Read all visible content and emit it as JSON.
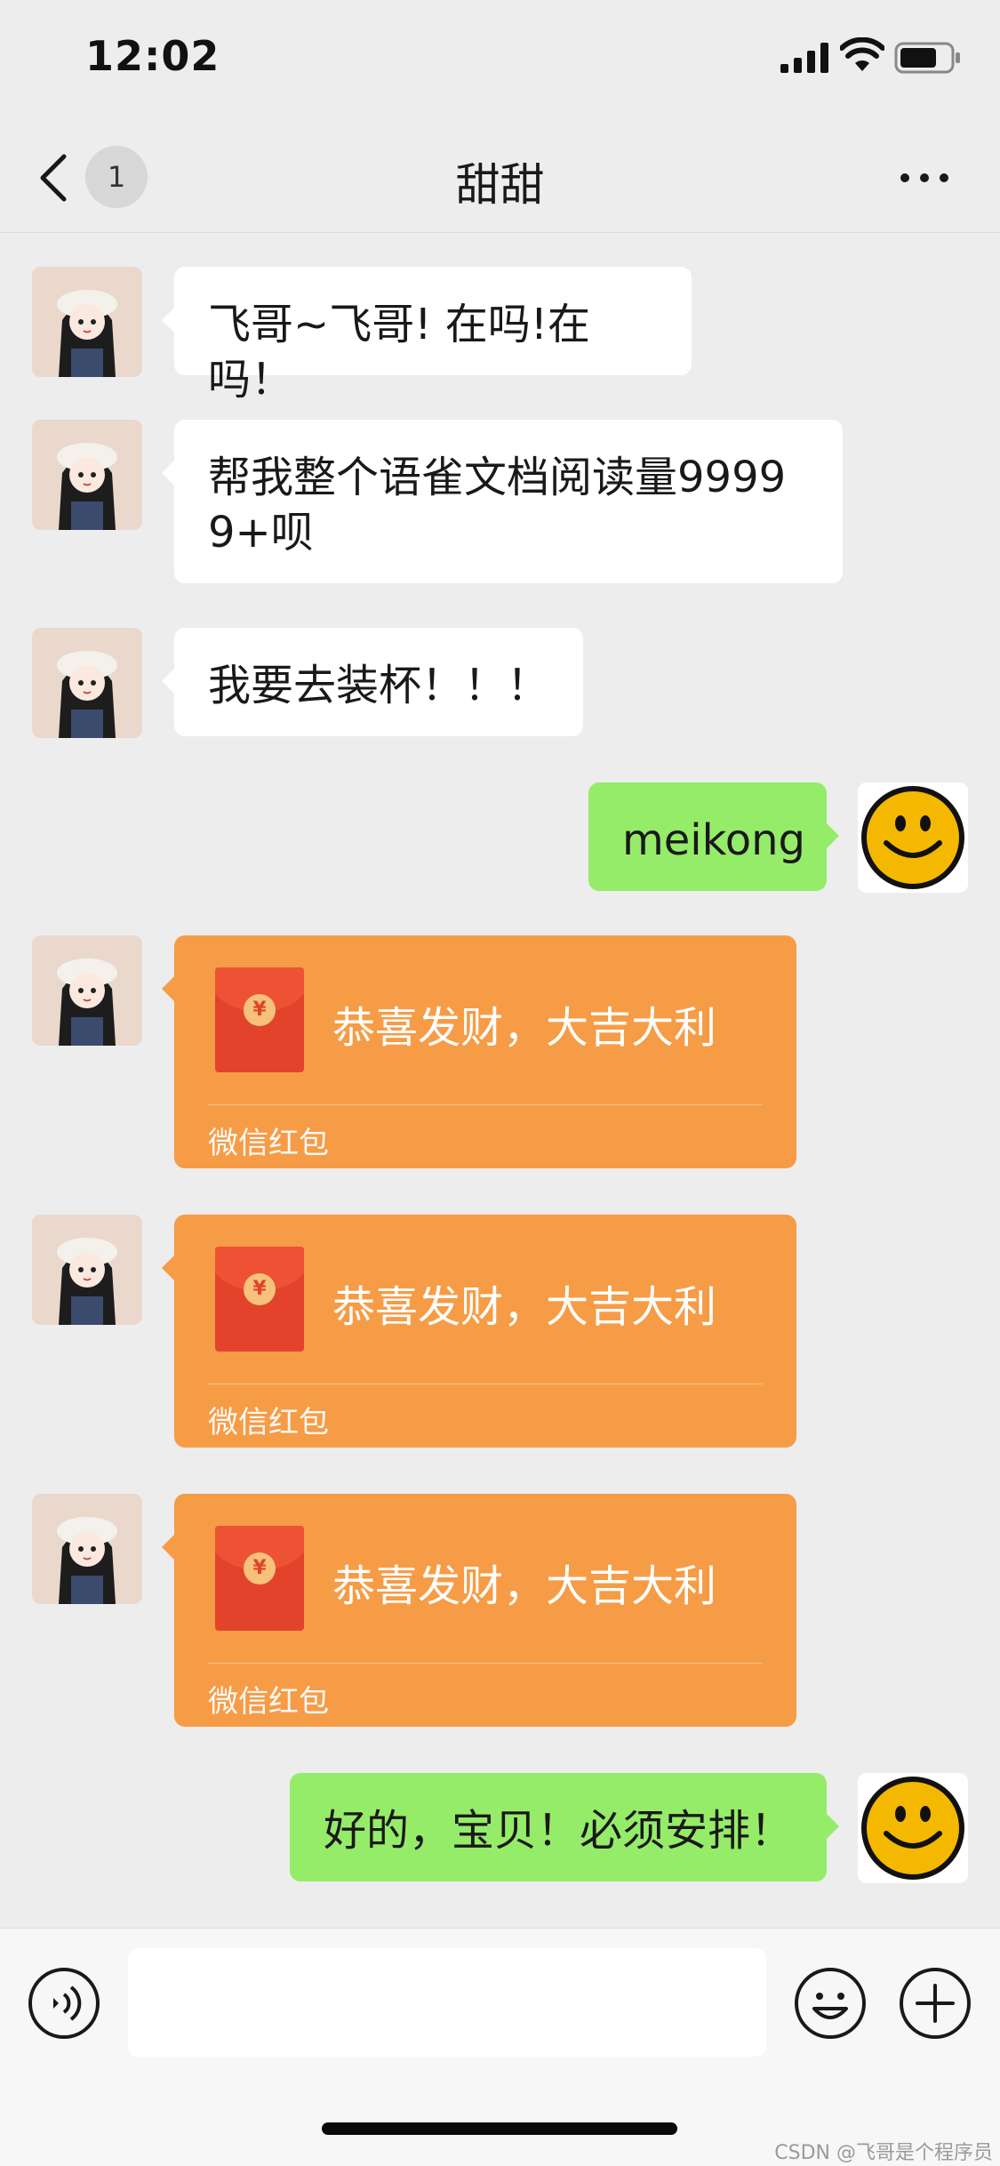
{
  "status_bar": {
    "time": "12:02"
  },
  "nav": {
    "unread_count": "1",
    "title": "甜甜"
  },
  "messages": [
    {
      "side": "in",
      "text": "飞哥~飞哥! 在吗!在吗！"
    },
    {
      "side": "in",
      "text": "帮我整个语雀文档阅读量99999+呗"
    },
    {
      "side": "in",
      "text": "我要去装杯！！！"
    },
    {
      "side": "out",
      "text": "meikong"
    },
    {
      "side": "in",
      "type": "red_packet",
      "title": "恭喜发财，大吉大利",
      "label": "微信红包"
    },
    {
      "side": "in",
      "type": "red_packet",
      "title": "恭喜发财，大吉大利",
      "label": "微信红包"
    },
    {
      "side": "in",
      "type": "red_packet",
      "title": "恭喜发财，大吉大利",
      "label": "微信红包"
    },
    {
      "side": "out",
      "text": "好的，宝贝！必须安排！"
    }
  ],
  "red_packet": {
    "currency_symbol": "¥"
  },
  "input": {
    "placeholder": ""
  },
  "watermark": "CSDN @飞哥是个程序员",
  "colors": {
    "background": "#ededed",
    "incoming_bubble": "#ffffff",
    "outgoing_bubble": "#95ec69",
    "red_packet": "#f69c46",
    "red_packet_envelope": "#e2432a"
  },
  "icons": {
    "back": "chevron-left-icon",
    "more": "more-dots-icon",
    "voice": "voice-icon",
    "emoji": "emoji-icon",
    "plus": "plus-icon"
  }
}
